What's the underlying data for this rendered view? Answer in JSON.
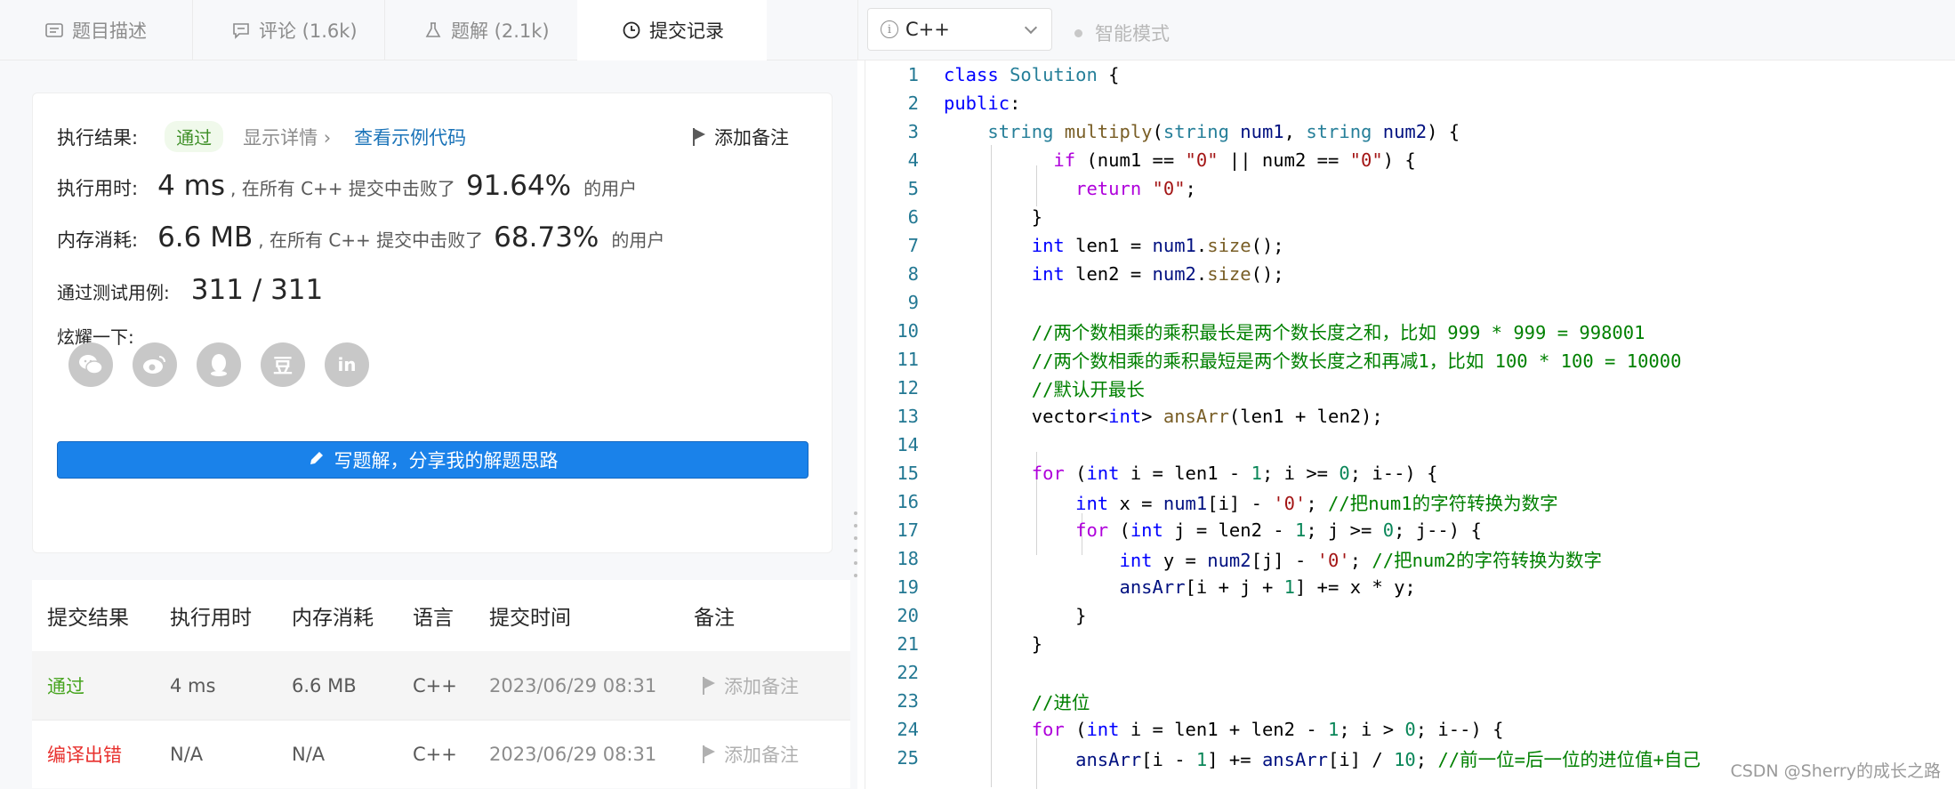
{
  "tabs": [
    {
      "label": "题目描述",
      "icon": "description-icon"
    },
    {
      "label": "评论 (1.6k)",
      "icon": "comment-icon"
    },
    {
      "label": "题解 (2.1k)",
      "icon": "flask-icon"
    },
    {
      "label": "提交记录",
      "icon": "clock-icon"
    }
  ],
  "result": {
    "exec_label": "执行结果:",
    "status": "通过",
    "details": "显示详情 ›",
    "example": "查看示例代码",
    "add_note": "添加备注",
    "time_label": "执行用时:",
    "time_value": "4 ms",
    "time_mid": ", 在所有 C++ 提交中击败了",
    "time_pct": "91.64%",
    "time_suffix": "的用户",
    "mem_label": "内存消耗:",
    "mem_value": "6.6 MB",
    "mem_mid": ", 在所有 C++ 提交中击败了",
    "mem_pct": "68.73%",
    "mem_suffix": "的用户",
    "tests_label": "通过测试用例:",
    "tests_value": "311 / 311",
    "share_label": "炫耀一下:",
    "social": [
      {
        "icon": "wechat-icon",
        "glyph": "✿"
      },
      {
        "icon": "weibo-icon",
        "glyph": "◉"
      },
      {
        "icon": "qq-icon",
        "glyph": "☻"
      },
      {
        "icon": "douban-icon",
        "glyph": "豆"
      },
      {
        "icon": "linkedin-icon",
        "glyph": "in"
      }
    ],
    "share_button": "写题解，分享我的解题思路"
  },
  "table": {
    "headers": [
      "提交结果",
      "执行用时",
      "内存消耗",
      "语言",
      "提交时间",
      "备注"
    ],
    "rows": [
      {
        "result": "通过",
        "time": "4 ms",
        "memory": "6.6 MB",
        "lang": "C++",
        "submitted": "2023/06/29 08:31",
        "note": "添加备注"
      },
      {
        "result": "编译出错",
        "time": "N/A",
        "memory": "N/A",
        "lang": "C++",
        "submitted": "2023/06/29 08:31",
        "note": "添加备注"
      }
    ]
  },
  "editor": {
    "language": "C++",
    "smart_mode": "智能模式",
    "line_numbers": [
      "1",
      "2",
      "3",
      "4",
      "5",
      "6",
      "7",
      "8",
      "9",
      "10",
      "11",
      "12",
      "13",
      "14",
      "15",
      "16",
      "17",
      "18",
      "19",
      "20",
      "21",
      "22",
      "23",
      "24",
      "25"
    ]
  },
  "watermark": "CSDN @Sherry的成长之路"
}
